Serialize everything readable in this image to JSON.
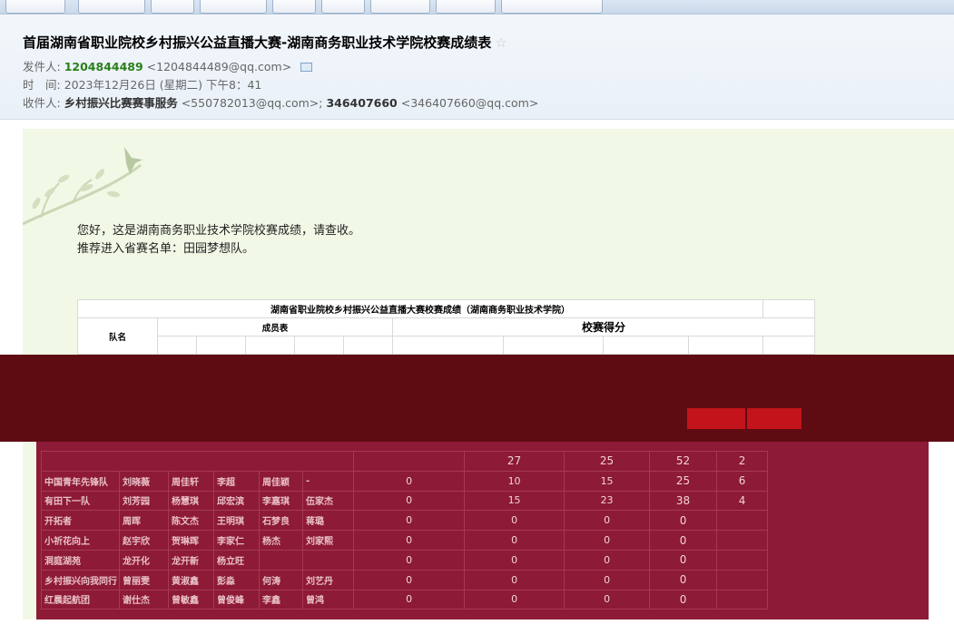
{
  "mail": {
    "subject": "首届湖南省职业院校乡村振兴公益直播大赛-湖南商务职业技术学院校赛成绩表",
    "from_label": "发件人:",
    "from_name": "1204844489",
    "from_addr": "<1204844489@qq.com>",
    "time_label": "时　间:",
    "time_value": "2023年12月26日 (星期二) 下午8：41",
    "to_label": "收件人:",
    "to_1_name": "乡村振兴比赛赛事服务",
    "to_1_addr": "<550782013@qq.com>;",
    "to_2_name": "346407660",
    "to_2_addr": "<346407660@qq.com>"
  },
  "body": {
    "line1": "您好，这是湖南商务职业技术学院校赛成绩，请查收。",
    "line2": "推荐进入省赛名单：田园梦想队。"
  },
  "table": {
    "title": "湖南省职业院校乡村振兴公益直播大赛校赛成绩（湖南商务职业技术学院）",
    "col_team": "队名",
    "col_members": "成员表",
    "col_scores": "校赛得分"
  },
  "rows": [
    {
      "team": "中国青年先锋队",
      "c1": "刘晓薇",
      "c2": "周佳轩",
      "c3": "李超",
      "c4": "周佳颖",
      "c5": "-",
      "s1": "0",
      "s2": "10",
      "s3": "15",
      "total": "25",
      "rank": "6"
    },
    {
      "team": "有田下一队",
      "c1": "刘芳园",
      "c2": "杨慧琪",
      "c3": "邱宏滨",
      "c4": "李嘉琪",
      "c5": "伍家杰",
      "s1": "0",
      "s2": "15",
      "s3": "23",
      "total": "38",
      "rank": "4"
    },
    {
      "team": "开拓者",
      "c1": "周晖",
      "c2": "陈文杰",
      "c3": "王明琪",
      "c4": "石梦良",
      "c5": "蒋璐",
      "s1": "0",
      "s2": "0",
      "s3": "0",
      "total": "0",
      "rank": ""
    },
    {
      "team": "小祈花向上",
      "c1": "赵宇欣",
      "c2": "贺琳晖",
      "c3": "李家仁",
      "c4": "杨杰",
      "c5": "刘家熙",
      "s1": "0",
      "s2": "0",
      "s3": "0",
      "total": "0",
      "rank": ""
    },
    {
      "team": "洞庭湖苑",
      "c1": "龙开化",
      "c2": "龙开新",
      "c3": "杨立旺",
      "c4": "",
      "c5": "",
      "s1": "0",
      "s2": "0",
      "s3": "0",
      "total": "0",
      "rank": ""
    },
    {
      "team": "乡村振兴向我同行",
      "c1": "曾丽雯",
      "c2": "黄淑鑫",
      "c3": "彭淼",
      "c4": "何涛",
      "c5": "刘艺丹",
      "s1": "0",
      "s2": "0",
      "s3": "0",
      "total": "0",
      "rank": ""
    },
    {
      "team": "红晨起航团",
      "c1": "谢仕杰",
      "c2": "曾敏鑫",
      "c3": "曾俊峰",
      "c4": "李鑫",
      "c5": "曾鸿",
      "s1": "0",
      "s2": "0",
      "s3": "0",
      "total": "0",
      "rank": ""
    }
  ],
  "partial_row": {
    "s2": "27",
    "s3": "25",
    "total": "52",
    "rank": "2"
  },
  "colors": {
    "band": "#5e0b12",
    "panel": "#8d1a36",
    "highlight": "#c2141a",
    "letter_bg": "#f1f8e6"
  },
  "icons": [
    "star-icon",
    "contact-card-icon",
    "branch-bird-decoration"
  ]
}
